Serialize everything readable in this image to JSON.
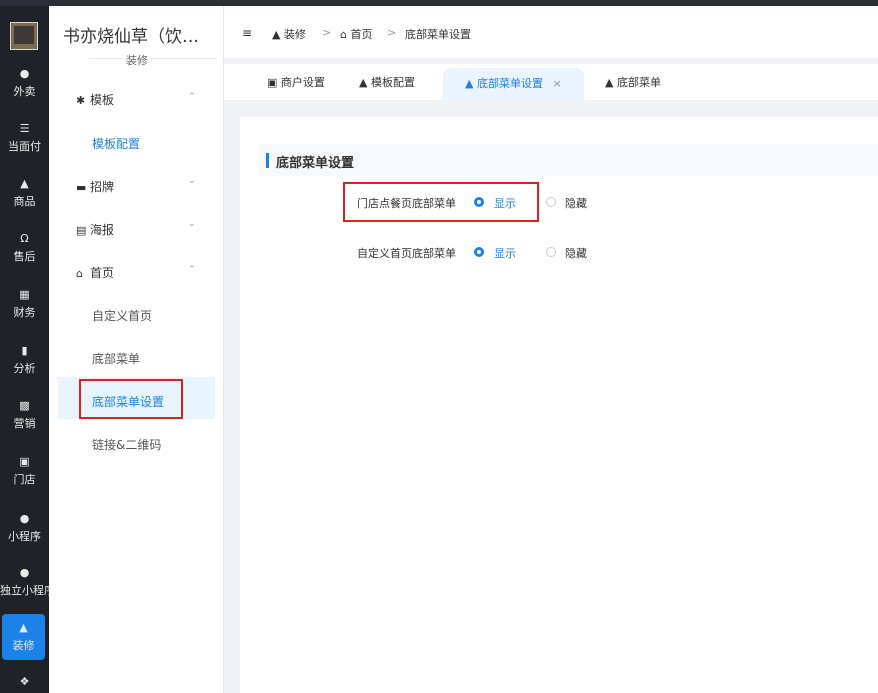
{
  "nav": {
    "items": [
      {
        "icon": "bike-icon",
        "label": "外卖"
      },
      {
        "icon": "list-icon",
        "label": "当面付"
      },
      {
        "icon": "goods-icon",
        "label": "商品"
      },
      {
        "icon": "headset-icon",
        "label": "售后"
      },
      {
        "icon": "finance-icon",
        "label": "财务"
      },
      {
        "icon": "chart-icon",
        "label": "分析"
      },
      {
        "icon": "gift-icon",
        "label": "营销"
      },
      {
        "icon": "store-icon",
        "label": "门店"
      },
      {
        "icon": "wechat-icon",
        "label": "小程序"
      },
      {
        "icon": "link-icon",
        "label": "独立小程序"
      },
      {
        "icon": "decorate-icon",
        "label": "装修"
      }
    ]
  },
  "sidebar": {
    "store_name": "书亦烧仙草（饮…",
    "store_sub": "装修",
    "groups": {
      "template": {
        "label": "模板",
        "items": [
          "模板配置"
        ]
      },
      "signboard": {
        "label": "招牌"
      },
      "poster": {
        "label": "海报"
      },
      "home": {
        "label": "首页",
        "items": [
          "自定义首页",
          "底部菜单",
          "底部菜单设置",
          "链接&二维码"
        ]
      }
    }
  },
  "breadcrumb": {
    "items": [
      "装修",
      "首页",
      "底部菜单设置"
    ],
    "sep": ">"
  },
  "tabs": [
    "商户设置",
    "模板配置",
    "底部菜单设置",
    "底部菜单"
  ],
  "tab_close": "×",
  "section_title": "底部菜单设置",
  "settings": [
    {
      "label": "门店点餐页底部菜单",
      "options": [
        "显示",
        "隐藏"
      ],
      "selected": "显示"
    },
    {
      "label": "自定义首页底部菜单",
      "options": [
        "显示",
        "隐藏"
      ],
      "selected": "显示"
    }
  ],
  "colors": {
    "accent": "#1a82e8",
    "highlight": "#e02020"
  }
}
